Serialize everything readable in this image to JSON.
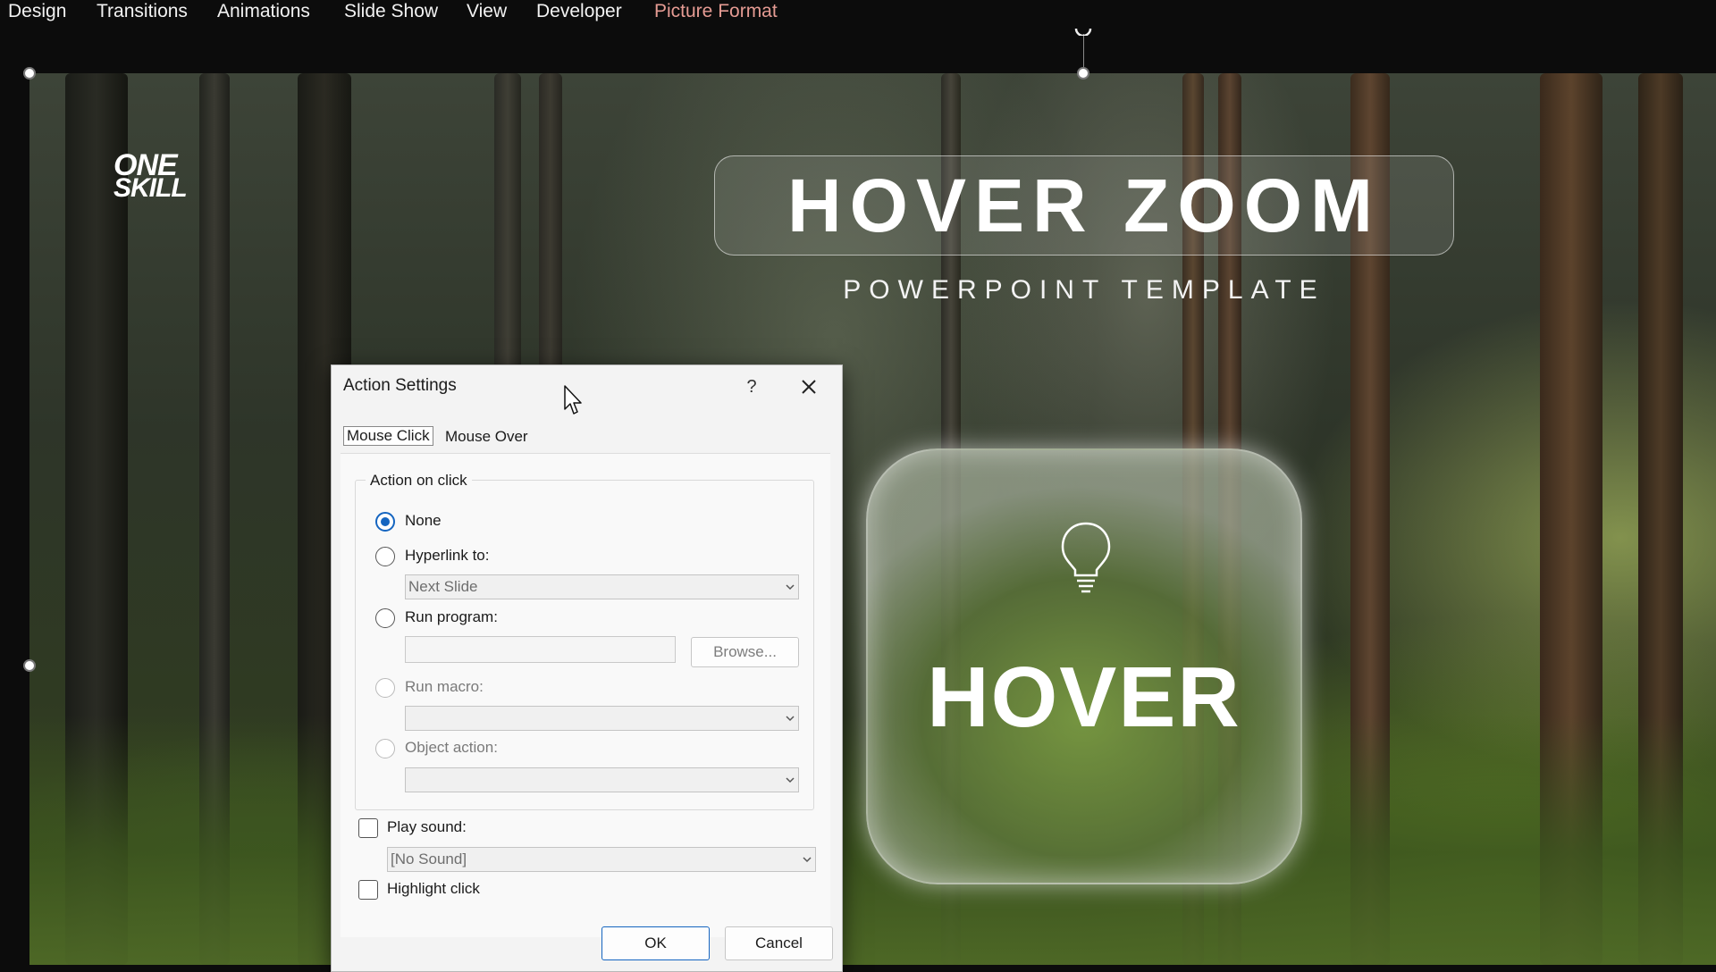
{
  "menubar": {
    "tabs": [
      {
        "label": "Design",
        "accent": false
      },
      {
        "label": "Transitions",
        "accent": false
      },
      {
        "label": "Animations",
        "accent": false
      },
      {
        "label": "Slide Show",
        "accent": false
      },
      {
        "label": "View",
        "accent": false
      },
      {
        "label": "Developer",
        "accent": false
      },
      {
        "label": "Picture Format",
        "accent": true
      }
    ],
    "accent_color": "#e59b93"
  },
  "slide": {
    "logo": {
      "line1": "ONE",
      "line2": "SKILL"
    },
    "title": "HOVER ZOOM",
    "subtitle": "POWERPOINT TEMPLATE",
    "card": {
      "icon": "lightbulb-icon",
      "word": "HOVER"
    }
  },
  "dialog": {
    "title": "Action Settings",
    "help_label": "?",
    "tabs": {
      "mouse_click": "Mouse Click",
      "mouse_over": "Mouse Over"
    },
    "group_label": "Action on click",
    "options": {
      "none": "None",
      "hyperlink": "Hyperlink to:",
      "run_program": "Run program:",
      "run_macro": "Run macro:",
      "object_action": "Object action:"
    },
    "selected_option": "None",
    "hyperlink_value": "Next Slide",
    "run_program_value": "",
    "browse_label": "Browse...",
    "play_sound_label": "Play sound:",
    "play_sound_checked": false,
    "sound_value": "[No Sound]",
    "highlight_click_label": "Highlight click",
    "highlight_click_checked": false,
    "ok_label": "OK",
    "cancel_label": "Cancel",
    "accent_color": "#1565c0"
  }
}
